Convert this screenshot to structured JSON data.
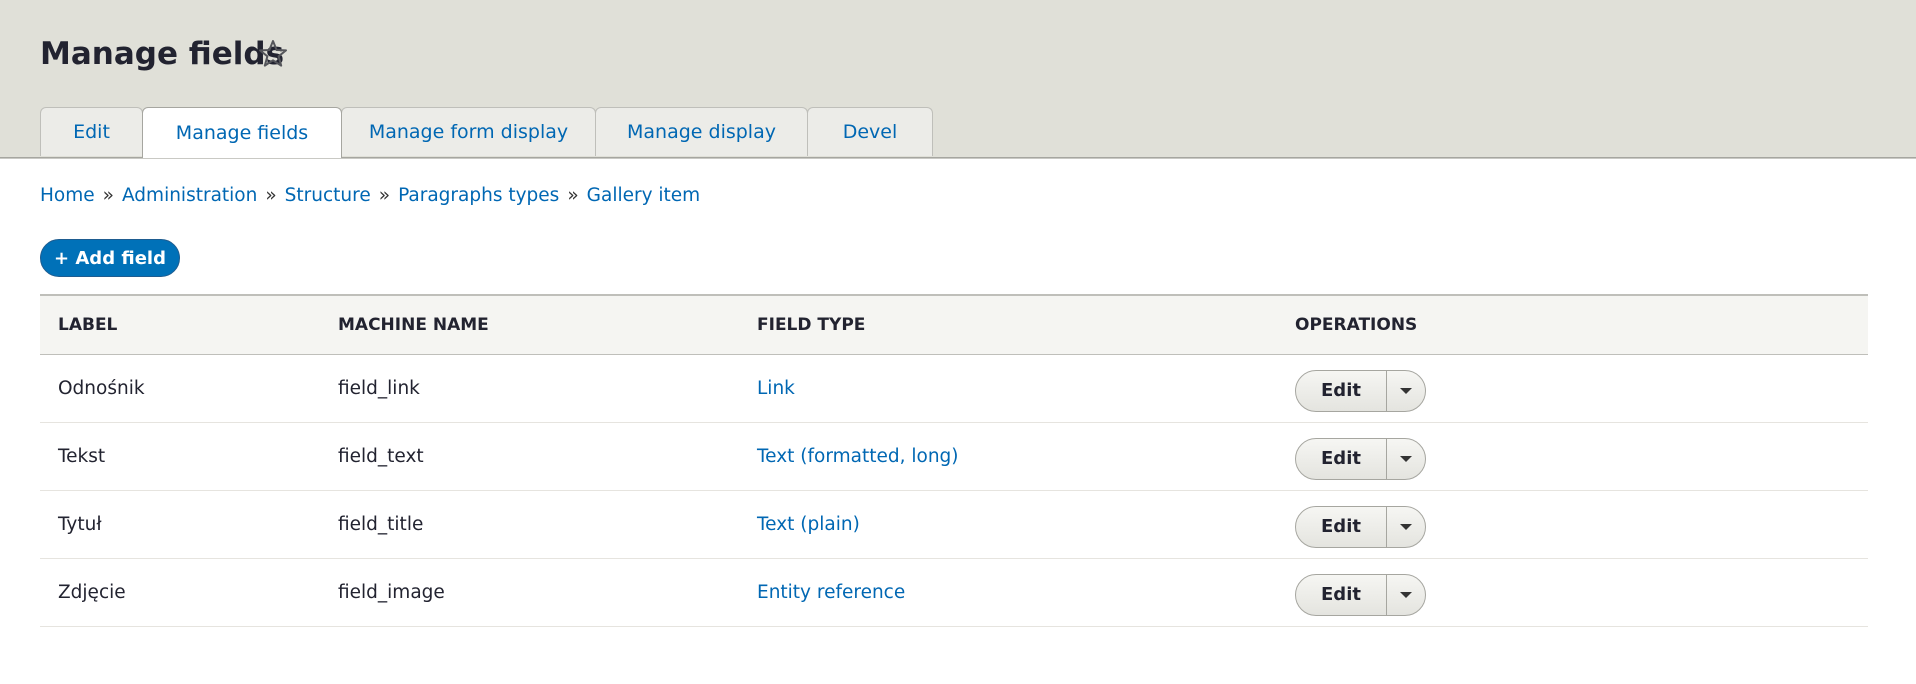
{
  "page": {
    "title": "Manage fields"
  },
  "tabs": [
    {
      "label": "Edit"
    },
    {
      "label": "Manage fields",
      "active": true
    },
    {
      "label": "Manage form display"
    },
    {
      "label": "Manage display"
    },
    {
      "label": "Devel"
    }
  ],
  "breadcrumb": {
    "items": [
      "Home",
      "Administration",
      "Structure",
      "Paragraphs types",
      "Gallery item"
    ],
    "separator": "»"
  },
  "actions": {
    "add_field": "+ Add field"
  },
  "table": {
    "headers": [
      "LABEL",
      "MACHINE NAME",
      "FIELD TYPE",
      "OPERATIONS"
    ],
    "rows": [
      {
        "label": "Odnośnik",
        "machine_name": "field_link",
        "field_type": "Link",
        "operation": "Edit"
      },
      {
        "label": "Tekst",
        "machine_name": "field_text",
        "field_type": "Text (formatted, long)",
        "operation": "Edit"
      },
      {
        "label": "Tytuł",
        "machine_name": "field_title",
        "field_type": "Text (plain)",
        "operation": "Edit"
      },
      {
        "label": "Zdjęcie",
        "machine_name": "field_image",
        "field_type": "Entity reference",
        "operation": "Edit"
      }
    ]
  },
  "icons": {
    "favorite": "star-outline-icon",
    "dropdown": "caret-down-icon"
  },
  "colors": {
    "link": "#0067b3",
    "primary_button": "#0071b8",
    "header_bg": "#e0e0d8"
  }
}
